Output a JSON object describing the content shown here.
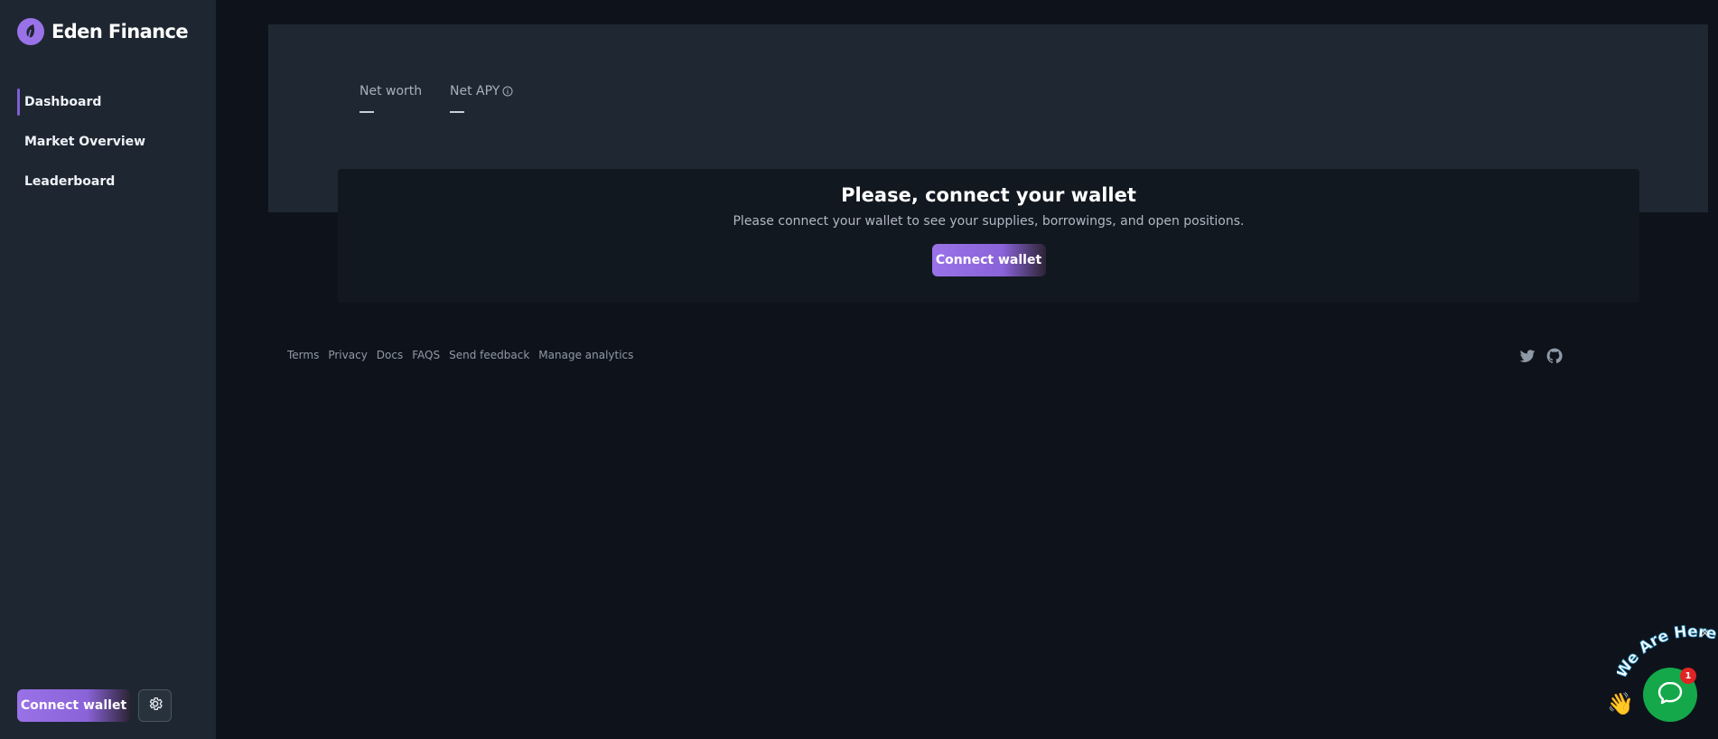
{
  "brand": {
    "name": "Eden Finance",
    "icon": "leaf-logo-icon",
    "accent": "#9a72e8"
  },
  "sidebar": {
    "items": [
      {
        "label": "Dashboard",
        "active": true
      },
      {
        "label": "Market Overview",
        "active": false
      },
      {
        "label": "Leaderboard",
        "active": false
      }
    ],
    "connect_label": "Connect wallet",
    "settings_icon": "gear-icon"
  },
  "stats": {
    "net_worth_label": "Net worth",
    "net_worth_value": "",
    "net_apy_label": "Net APY",
    "net_apy_value": ""
  },
  "connect_card": {
    "title": "Please, connect your wallet",
    "description": "Please connect your wallet to see your supplies, borrowings, and open positions.",
    "button_label": "Connect wallet"
  },
  "footer": {
    "links": [
      "Terms",
      "Privacy",
      "Docs",
      "FAQS",
      "Send feedback",
      "Manage analytics"
    ],
    "social_icons": [
      "twitter-icon",
      "github-icon"
    ]
  },
  "chat_widget": {
    "banner_text": "We Are Here!",
    "badge_count": "1",
    "close_glyph": "×",
    "bubble_color": "#14a84a"
  }
}
